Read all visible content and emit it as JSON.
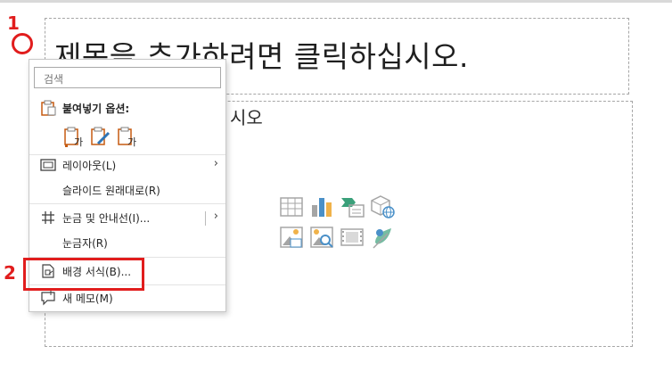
{
  "slide": {
    "title_placeholder": "제목을 추가하려면 클릭하십시오.",
    "content_placeholder_visible": "시오",
    "insert_icons": [
      "table-icon",
      "chart-icon",
      "smartart-icon",
      "3d-model-icon",
      "picture-icon",
      "online-picture-icon",
      "video-icon",
      "icons-icon"
    ]
  },
  "annotations": {
    "step1": "1",
    "step2": "2"
  },
  "context_menu": {
    "search_placeholder": "검색",
    "paste_options_label": "붙여넣기 옵션:",
    "items": [
      {
        "label": "레이아웃(L)",
        "icon": "layout-icon",
        "submenu": true
      },
      {
        "label": "슬라이드 원래대로(R)",
        "icon": "",
        "submenu": false
      },
      {
        "label": "눈금 및 안내선(I)...",
        "icon": "grid-icon",
        "submenu": true
      },
      {
        "label": "눈금자(R)",
        "icon": "",
        "submenu": false
      },
      {
        "label": "배경 서식(B)...",
        "icon": "format-background-icon",
        "submenu": false
      },
      {
        "label": "새 메모(M)",
        "icon": "new-comment-icon",
        "submenu": false
      }
    ]
  },
  "colors": {
    "annotation_red": "#e11d1d",
    "accent_orange": "#c55a11",
    "accent_blue": "#2e75b6"
  }
}
